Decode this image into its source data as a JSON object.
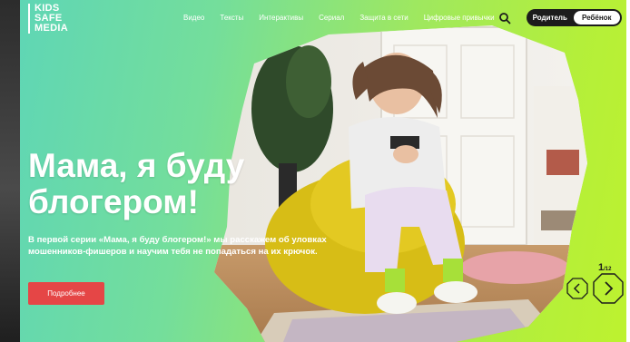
{
  "brand": {
    "logo_lines": [
      "KIDS",
      "SAFE",
      "MEDIA"
    ]
  },
  "nav": {
    "items": [
      "Видео",
      "Тексты",
      "Интерактивы",
      "Сериал",
      "Защита в сети",
      "Цифровые привычки"
    ]
  },
  "role_toggle": {
    "options": [
      "Родитель",
      "Ребёнок"
    ],
    "selected": "Родитель"
  },
  "hero": {
    "title_line1": "Мама, я буду",
    "title_line2": "блогером!",
    "description": "В первой серии «Мама, я буду блогером!» мы расскажем об уловках мошенников-фишеров и научим тебя не попадаться на их крючок.",
    "cta_label": "Подробнее"
  },
  "pager": {
    "current": "1",
    "separator": "/",
    "total": "12"
  },
  "icons": {
    "search": "search-icon",
    "prev": "chevron-left-icon",
    "next": "chevron-right-icon"
  },
  "colors": {
    "gradient_start": "#5fd6b5",
    "gradient_end": "#bdf22f",
    "cta": "#e54646",
    "toggle_bg": "#1c1c1c"
  }
}
